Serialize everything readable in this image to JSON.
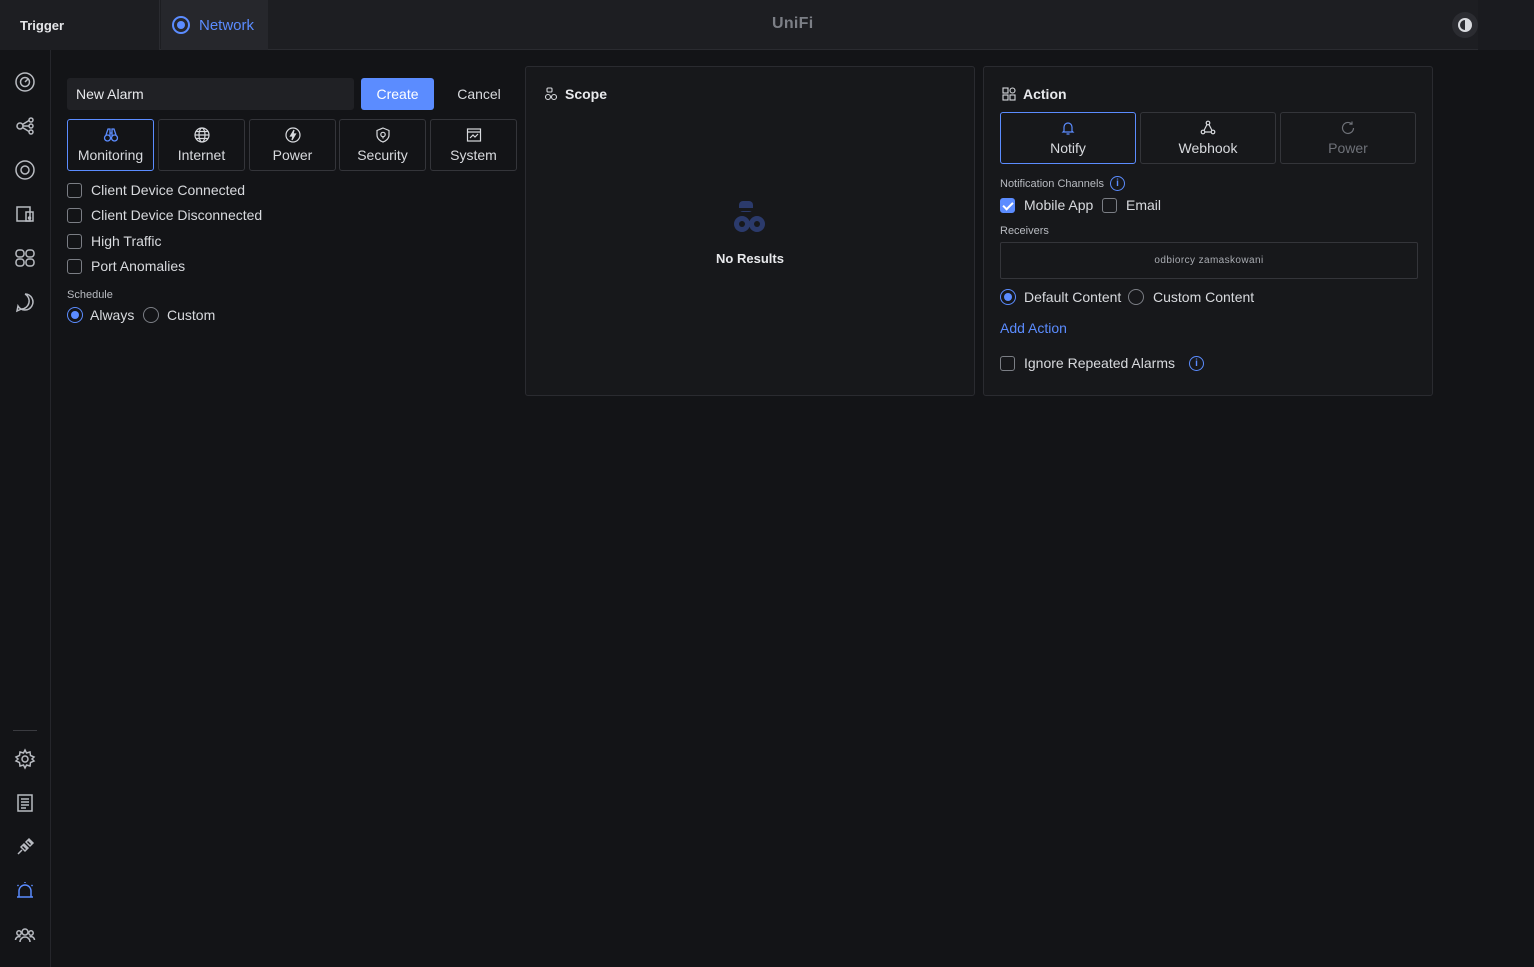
{
  "topbar": {
    "trigger_label": "Trigger",
    "network_label": "Network",
    "brand": "UniFi"
  },
  "sidebar": {
    "items": [
      {
        "icon": "dashboard-icon"
      },
      {
        "icon": "topology-icon"
      },
      {
        "icon": "target-icon"
      },
      {
        "icon": "devices-icon"
      },
      {
        "icon": "clients-icon"
      },
      {
        "icon": "insights-icon"
      },
      {
        "icon": "settings-icon"
      },
      {
        "icon": "logs-icon"
      },
      {
        "icon": "integrations-icon"
      },
      {
        "icon": "alarm-icon"
      },
      {
        "icon": "users-icon"
      }
    ]
  },
  "alarm": {
    "name_value": "New Alarm",
    "create_label": "Create",
    "cancel_label": "Cancel"
  },
  "categories": [
    {
      "label": "Monitoring",
      "icon": "binoculars-icon",
      "active": true
    },
    {
      "label": "Internet",
      "icon": "globe-icon",
      "active": false
    },
    {
      "label": "Power",
      "icon": "bolt-icon",
      "active": false
    },
    {
      "label": "Security",
      "icon": "shield-icon",
      "active": false
    },
    {
      "label": "System",
      "icon": "system-icon",
      "active": false
    }
  ],
  "triggers": [
    {
      "label": "Client Device Connected",
      "checked": false
    },
    {
      "label": "Client Device Disconnected",
      "checked": false
    },
    {
      "label": "High Traffic",
      "checked": false
    },
    {
      "label": "Port Anomalies",
      "checked": false
    }
  ],
  "schedule": {
    "label": "Schedule",
    "always_label": "Always",
    "custom_label": "Custom",
    "selected": "Always"
  },
  "scope": {
    "title": "Scope",
    "empty_text": "No Results"
  },
  "action": {
    "title": "Action",
    "tabs": [
      {
        "label": "Notify",
        "icon": "bell-icon",
        "state": "active"
      },
      {
        "label": "Webhook",
        "icon": "webhook-icon",
        "state": "normal"
      },
      {
        "label": "Power",
        "icon": "refresh-icon",
        "state": "disabled"
      }
    ],
    "channels_label": "Notification Channels",
    "mobile_app_label": "Mobile App",
    "email_label": "Email",
    "receivers_label": "Receivers",
    "receivers_value": "odbiorcy zamaskowani",
    "default_content_label": "Default Content",
    "custom_content_label": "Custom Content",
    "add_action_label": "Add Action",
    "ignore_repeated_label": "Ignore Repeated Alarms"
  },
  "colors": {
    "accent": "#5b8cff",
    "background": "#131417",
    "card": "#17181b"
  }
}
